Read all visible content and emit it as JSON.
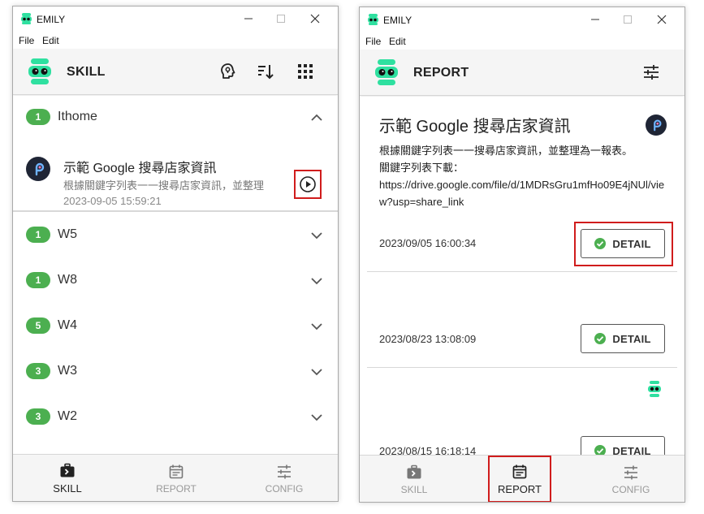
{
  "colors": {
    "accent_green": "#4caf50",
    "highlight_red": "#d01c1c",
    "logo_green": "#2fe0a0",
    "appbar_bg": "#f5f5f5"
  },
  "left": {
    "window": {
      "title": "EMILY"
    },
    "menu": [
      "File",
      "Edit"
    ],
    "appbar": {
      "title": "SKILL",
      "icons": [
        "bulb-head-icon",
        "sort-icon",
        "grid-menu-icon"
      ]
    },
    "groups": [
      {
        "count": "1",
        "label": "Ithome",
        "expanded": true
      },
      {
        "count": "1",
        "label": "W5"
      },
      {
        "count": "1",
        "label": "W8"
      },
      {
        "count": "5",
        "label": "W4"
      },
      {
        "count": "3",
        "label": "W3"
      },
      {
        "count": "3",
        "label": "W2"
      }
    ],
    "skill": {
      "title": "示範 Google 搜尋店家資訊",
      "desc": "根據關鍵字列表一一搜尋店家資訊，並整理",
      "time": "2023-09-05 15:59:21"
    },
    "nav": [
      {
        "label": "SKILL",
        "active": true
      },
      {
        "label": "REPORT"
      },
      {
        "label": "CONFIG"
      }
    ]
  },
  "right": {
    "window": {
      "title": "EMILY"
    },
    "menu": [
      "File",
      "Edit"
    ],
    "appbar": {
      "title": "REPORT",
      "icons": [
        "filter-sliders-icon"
      ]
    },
    "report": {
      "title": "示範 Google 搜尋店家資訊",
      "lines": [
        "根據關鍵字列表一一搜尋店家資訊，並整理為一報表。",
        "關鍵字列表下載：",
        "https://drive.google.com/file/d/1MDRsGru1mfHo09E4jNUl/view?usp=share_link"
      ]
    },
    "entries": [
      {
        "time": "2023/09/05 16:00:34",
        "button": "DETAIL"
      },
      {
        "time": "2023/08/23 13:08:09",
        "button": "DETAIL"
      },
      {
        "time": "2023/08/15 16:18:14",
        "button": "DETAIL"
      }
    ],
    "nav": [
      {
        "label": "SKILL"
      },
      {
        "label": "REPORT",
        "active": true
      },
      {
        "label": "CONFIG"
      }
    ]
  }
}
